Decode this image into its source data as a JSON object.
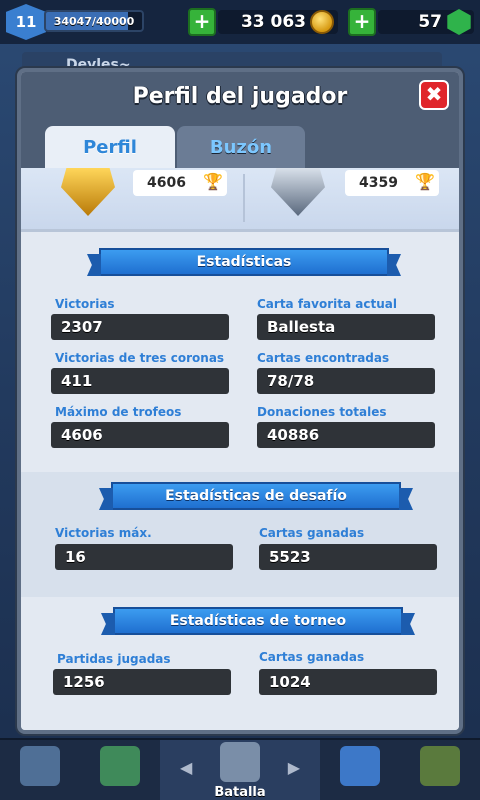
{
  "topbar": {
    "level": "11",
    "xp_text": "34047/40000",
    "xp_fraction": 0.85,
    "gold": "33 063",
    "gems": "57",
    "plus_label": "+"
  },
  "behind": {
    "player_name": "Deyles~"
  },
  "modal": {
    "title": "Perfil del jugador",
    "close_label": "✖",
    "tabs": [
      {
        "label": "Perfil",
        "active": true
      },
      {
        "label": "Buzón",
        "active": false
      }
    ]
  },
  "arena": {
    "current_trophies": "4606",
    "best_trophies": "4359",
    "trophy_glyph": "🏆"
  },
  "sections": {
    "stats": {
      "title": "Estadísticas",
      "items": [
        {
          "label": "Victorias",
          "value": "2307"
        },
        {
          "label": "Carta favorita actual",
          "value": "Ballesta"
        },
        {
          "label": "Victorias de tres coronas",
          "value": "411"
        },
        {
          "label": "Cartas encontradas",
          "value": "78/78"
        },
        {
          "label": "Máximo de trofeos",
          "value": "4606"
        },
        {
          "label": "Donaciones totales",
          "value": "40886"
        }
      ]
    },
    "challenge": {
      "title": "Estadísticas de desafío",
      "items": [
        {
          "label": "Victorias máx.",
          "value": "16"
        },
        {
          "label": "Cartas ganadas",
          "value": "5523"
        }
      ]
    },
    "tournament": {
      "title": "Estadísticas de torneo",
      "items": [
        {
          "label": "Partidas jugadas",
          "value": "1256"
        },
        {
          "label": "Cartas ganadas",
          "value": "1024"
        }
      ]
    }
  },
  "bottom_nav": {
    "active_label": "Batalla",
    "arrow_left": "◀",
    "arrow_right": "▶",
    "icons": [
      "shop-icon",
      "cards-icon",
      "battle-icon",
      "clan-icon",
      "tournament-icon"
    ]
  },
  "colors": {
    "accent_blue": "#2f7fd6",
    "ribbon_blue": "#1f6fd0",
    "close_red": "#e0262b",
    "plus_green": "#36b33a"
  }
}
